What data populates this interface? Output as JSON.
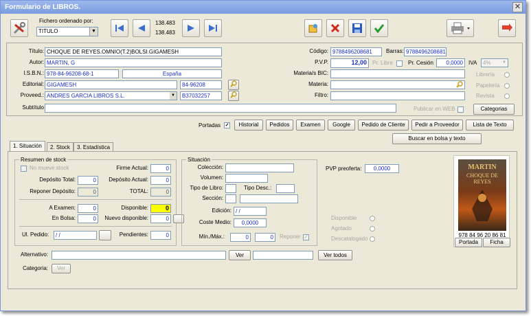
{
  "window": {
    "title": "Formulario de LIBROS.",
    "close": "✕"
  },
  "toolbar": {
    "sort_label": "Fichero ordenado por:",
    "sort_value": "TITULO",
    "counter_top": "138.483",
    "counter_bottom": "138.483"
  },
  "fields": {
    "titulo_label": "Título:",
    "titulo": "CHOQUE DE REYES.OMNIO(T.2)BOLSI.GIGAMESH",
    "autor_label": "Autor:",
    "autor": "MARTIN, G",
    "isbn_label": "I.S.B.N.:",
    "isbn": "978-84-96208-68-1",
    "pais": "España",
    "editorial_label": "Editorial:",
    "editorial": "GIGAMESH",
    "editorial_code": "84-96208",
    "proveed_label": "Proveed.:",
    "proveed": "ANDRES GARCIA LIBROS S.L.",
    "proveed_code": "B37032257",
    "subtitulo_label": "Subtítulo",
    "codigo_label": "Código:",
    "codigo": "9788496208681",
    "barras_label": "Barras:",
    "barras": "9788496208681",
    "pvp_label": "P.V.P.",
    "pvp": "12,00",
    "pr_libre_label": "Pr. Libre",
    "pr_cesion_label": "Pr. Cesión",
    "pr_cesion": "0,0000",
    "iva_label": "IVA",
    "iva": "4%",
    "materia_bic_label": "Materia/s BIC:",
    "materia_label": "Materia:",
    "filtro_label": "Filtro:",
    "libreria": "Librería",
    "papeleria": "Papelería",
    "revista": "Revista",
    "publicar_label": "Publicar en WEB",
    "categorias": "Categorias"
  },
  "actions": {
    "portadas": "Portadas",
    "historial": "Historial",
    "pedidos": "Pedidos",
    "examen": "Examen",
    "google": "Google",
    "pedido_cliente": "Pedido de Cliente",
    "pedir_proveedor": "Pedir a Proveedor",
    "lista_texto": "Lista de Texto",
    "buscar_bolsa": "Buscar en bolsa y texto"
  },
  "tabs": [
    "1. Situación",
    "2. Stock",
    "3. Estadística"
  ],
  "stock": {
    "group_title": "Resumen de stock",
    "no_mueve": "No mueve stock",
    "firme_label": "Firme Actual:",
    "firme": "0",
    "deposito_total_label": "Depósito Total:",
    "deposito_total": "0",
    "deposito_actual_label": "Depósito Actual:",
    "deposito_actual": "0",
    "reponer_label": "Reponer Depósito:",
    "reponer": "0",
    "total_label": "TOTAL:",
    "total": "0",
    "a_examen_label": "A Examen:",
    "a_examen": "0",
    "disponible_label": "Disponible:",
    "disponible": "0",
    "en_bolsa_label": "En Bolsa:",
    "en_bolsa": "0",
    "nuevo_disp_label": "Nuevo disponible:",
    "nuevo_disp": "0",
    "ul_pedido_label": "Ul. Pedido:",
    "ul_pedido": "/ /",
    "pendientes_label": "Pendientes:",
    "pendientes": "0"
  },
  "situacion": {
    "group_title": "Situación",
    "coleccion": "Colección:",
    "volumen": "Volumen:",
    "tipo_libro": "Tipo de Libro:",
    "tipo_desc": "Tipo Desc.:",
    "seccion": "Sección:",
    "edicion_label": "Edición:",
    "edicion": "/ /",
    "coste_label": "Coste Medio:",
    "coste": "0,0000",
    "minmax_label": "Mín./Máx.:",
    "min": "0",
    "max": "0",
    "reponer": "Reponer"
  },
  "right": {
    "pvp_preoferta_label": "PVP preoferta:",
    "pvp_preoferta": "0,0000",
    "disponible": "Disponible",
    "agotado": "Agotado",
    "descatalogado": "Descatalogado"
  },
  "cover": {
    "author": "MARTIN",
    "title": "CHOQUE DE REYES",
    "isbn_text": "978 84 96 20 86 81",
    "portada_btn": "Portada",
    "ficha_btn": "Ficha"
  },
  "bottom": {
    "alternativo_label": "Alternativo:",
    "ver": "Ver",
    "ver_todos": "Ver todos",
    "categoria_label": "Categoria:",
    "ver2": "Ver"
  }
}
